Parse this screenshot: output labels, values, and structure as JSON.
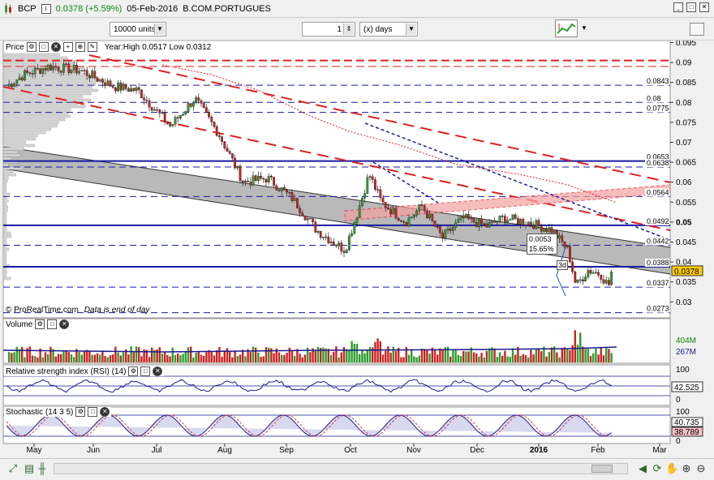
{
  "titlebar": {
    "symbol": "BCP",
    "price_change": "0.0378 (+5.59%)",
    "date": "05-Feb-2016",
    "exchange": "B.COM.PORTUGUES"
  },
  "toolbar": {
    "units_value": "10000 units",
    "period_count": "1",
    "period_unit": "(x) days"
  },
  "price_panel": {
    "label": "Price",
    "year_range": "Year:High 0.0517 Low 0.0312",
    "copyright": "© ProRealTime.com",
    "note": "Data is end of day",
    "last_price": "0.0378",
    "axis_ticks": [
      "0.095",
      "0.09",
      "0.085",
      "0.08",
      "0.075",
      "0.07",
      "0.065",
      "0.06",
      "0.055",
      "0.05",
      "0.045",
      "0.04",
      "0.035",
      "0.03"
    ],
    "level_labels": [
      "0.0843",
      "0.08",
      "0.0775",
      "0.0653",
      "0.0638",
      "0.0564",
      "0.0492",
      "0.0442",
      "0.0388",
      "0.0337",
      "0.0273"
    ],
    "annotation_box": [
      "0.0053",
      "15.65%"
    ],
    "annotation_days": "3d"
  },
  "volume_panel": {
    "label": "Volume",
    "axis": [
      "404M",
      "267M"
    ]
  },
  "rsi_panel": {
    "label": "Relative strength index (RSI) (14)",
    "axis": [
      "100",
      "42.525",
      "0"
    ]
  },
  "stoch_panel": {
    "label": "Stochastic (14 3 5)",
    "axis": [
      "100",
      "40.735",
      "38.789",
      "0"
    ]
  },
  "x_axis": [
    "May",
    "Jun",
    "Jul",
    "Aug",
    "Sep",
    "Oct",
    "Nov",
    "Dec",
    "2016",
    "Feb",
    "Mar"
  ],
  "colors": {
    "up": "#2e9e2e",
    "down": "#cc2222",
    "level": "#1a1aa0",
    "trend_red": "#e02020",
    "channel_gray": "#a8a8a8"
  }
}
